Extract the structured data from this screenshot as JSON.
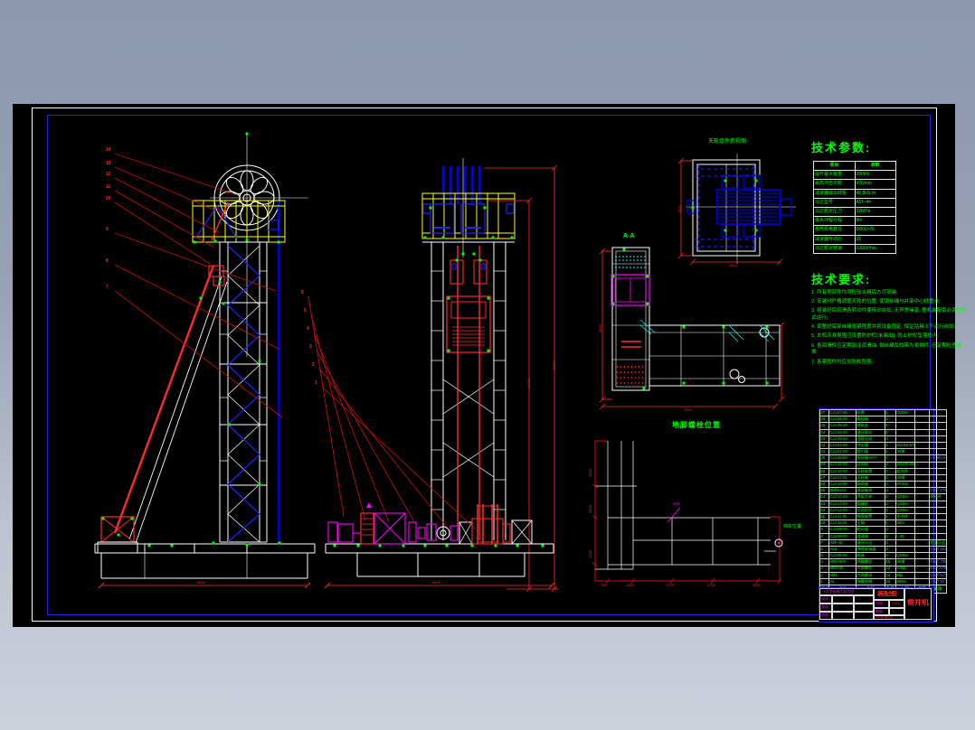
{
  "window": {
    "background_top": "#8b98ae",
    "background_bottom": "#ccd1dc",
    "canvas_color": "#000000",
    "frame_white": "#ffffff",
    "frame_blue": "#2020e8",
    "line_red": "#ff2a2a",
    "line_yellow": "#ffff00",
    "line_magenta": "#ff00ff",
    "line_cyan": "#00ffff",
    "text_green": "#00ff00"
  },
  "labels": {
    "plan_top": "天轮组件俯视图",
    "section": "A-A",
    "anchor_title": "地脚螺栓位置",
    "anchor_point": "挡车位置"
  },
  "tech_params": {
    "title": "技术参数:",
    "headers": [
      "项目",
      "参数"
    ],
    "rows": [
      [
        "提升最大载重",
        "200kN"
      ],
      [
        "最高冲击次数",
        "4次/min"
      ],
      [
        "减速器输出转矩",
        "42.8kN·m"
      ],
      [
        "马达型号",
        "A2F-44"
      ],
      [
        "马达额定压力",
        "32MPa"
      ],
      [
        "最大冲程行程",
        "8m"
      ],
      [
        "卷筒规格直径",
        "D800×75"
      ],
      [
        "减速器传动比",
        "35"
      ],
      [
        "马达额定转速",
        "1000r/min"
      ]
    ]
  },
  "tech_requirements": {
    "title": "技术要求:",
    "items": [
      "1. 所有零部件均须检验合格后方可安装;",
      "2. 安装时严格调整天轮的位置, 使钢丝绳与井架中心线重合;",
      "3. 组装好后润滑各转动件使传动自如, 无异常噪音, 整机装配后必须进行试运行;",
      "4. 调整好底部丝绳张紧程度并将设备固定, 保证钻具上下运行自如;",
      "5. 本机床身周围应设置防护栏(未画出), 防止护栏坠落伤人;",
      "6. 各润滑件应定期加注润滑油, 钢丝绳及胶带为易损件, 应定期检查更换;",
      "7. 各紧固件均应加防松垫圈。"
    ]
  },
  "parts_list": {
    "headers": [
      "序号",
      "代号",
      "名称",
      "数量",
      "材料",
      "重量",
      "备注"
    ],
    "rows": [
      [
        "27",
        "CJJ-27-00",
        "护罩",
        "1",
        "Q235A",
        "",
        ""
      ],
      [
        "26",
        "CJJ-26-00",
        "电控箱",
        "1",
        "",
        "",
        ""
      ],
      [
        "25",
        "CJJ-25-00",
        "操纵台",
        "1",
        "",
        "",
        ""
      ],
      [
        "24",
        "CJJ-24-00",
        "液压泵站",
        "1",
        "",
        "",
        ""
      ],
      [
        "23",
        "CJJ-23-00",
        "油管总成",
        "4",
        "",
        "",
        ""
      ],
      [
        "22",
        "CJJ-22-00",
        "冲击锤",
        "1",
        "ZG310-570",
        "",
        ""
      ],
      [
        "21",
        "CJJ-21-00",
        "提引器",
        "1",
        "35钢",
        "",
        ""
      ],
      [
        "20",
        "CJJ-20-00",
        "钢丝绳18×7",
        "2",
        "",
        "",
        "GB 8918"
      ],
      [
        "19",
        "CJJ-19-00",
        "导向轮",
        "2",
        "ZG270-500",
        "",
        ""
      ],
      [
        "18",
        "CJJ-18-00",
        "天轮装置",
        "1",
        "组合件",
        "",
        ""
      ],
      [
        "17",
        "CJJ-17-01",
        "天轮轴",
        "1",
        "45钢",
        "",
        ""
      ],
      [
        "16",
        "CJJ-16-00",
        "轴承座",
        "2",
        "HT200",
        "",
        ""
      ],
      [
        "15",
        "轴承6324",
        "滚动轴承",
        "4",
        "",
        "",
        "GB/T 276"
      ],
      [
        "14",
        "CJJ-14-00",
        "井架主体",
        "1",
        "Q235A",
        "",
        "焊接件"
      ],
      [
        "13",
        "CJJ-13-00",
        "斜撑杆",
        "2",
        "Q235A",
        "",
        ""
      ],
      [
        "12",
        "CJJ-12-00",
        "平台栏杆",
        "1",
        "Q235A",
        "",
        ""
      ],
      [
        "11",
        "CJJ-11-00",
        "卷筒装置",
        "1",
        "组合件",
        "",
        ""
      ],
      [
        "10",
        "CJJ-10-01",
        "主轴",
        "1",
        "40Cr",
        "",
        ""
      ],
      [
        "9",
        "CJJ-09-00",
        "制动器",
        "2",
        "",
        "",
        ""
      ],
      [
        "8",
        "CJJ-08-00",
        "减速器",
        "1",
        "i=35",
        "",
        ""
      ],
      [
        "7",
        "A2F-44",
        "液压马达",
        "2",
        "",
        "",
        "定量马达"
      ],
      [
        "6",
        "HL5",
        "弹性联轴器",
        "2",
        "",
        "",
        "GB/T 5014"
      ],
      [
        "5",
        "CJJ-05-00",
        "机座",
        "1",
        "Q235A",
        "",
        ""
      ],
      [
        "4",
        "M36×800",
        "地脚螺栓",
        "16",
        "35钢",
        "",
        "GB/T 799"
      ],
      [
        "3",
        "M24×80",
        "六角螺栓",
        "24",
        "8.8级",
        "",
        "GB/T 5782"
      ],
      [
        "2",
        "M24",
        "六角螺母",
        "24",
        "8级",
        "",
        "GB/T 6170"
      ],
      [
        "1",
        "24",
        "弹簧垫圈",
        "24",
        "65Mn",
        "",
        "GB/T 93"
      ]
    ]
  },
  "title_block": {
    "unit_line": "××大学机械工程学院",
    "role_rows": [
      "设计",
      "制图",
      "审核"
    ],
    "drawing_type": "装配图",
    "scale_label": "比例",
    "scale": "1:40",
    "qty_label": "数量",
    "qty": "1",
    "sheet": "共1张 第1张",
    "title": "凿井机"
  },
  "balloons": {
    "left": [
      "14",
      "13",
      "12",
      "11",
      "10",
      "9",
      "8",
      "7"
    ],
    "middle": [
      "6",
      "5",
      "4",
      "3",
      "2",
      "1"
    ]
  },
  "dimensions": {
    "base_width": "6500",
    "machine_base": "5400",
    "elevation_inner": "21000",
    "elevation_outer": "28000",
    "plan_left": "3400",
    "plan_bottom": "2600",
    "section_left": "5600",
    "section_bottom": "7200",
    "anchor_bottom": [
      "750",
      "1600",
      "2700",
      "2700",
      "3000"
    ],
    "anchor_left": [
      "2500",
      "1500",
      "1200"
    ],
    "anchor_note": "M36"
  }
}
